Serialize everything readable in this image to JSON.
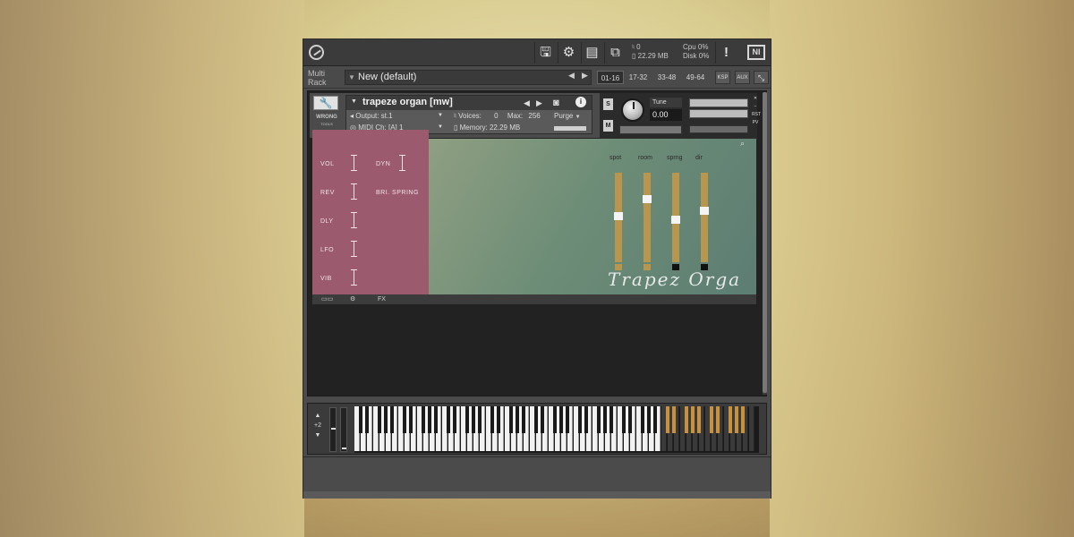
{
  "topbar": {
    "save_icon": "save-icon",
    "gear_icon": "gear-icon",
    "layout_icon": "layout-icon",
    "resize_icon": "resize-icon",
    "voices": "0",
    "memory": "22.29 MB",
    "cpu_label": "Cpu",
    "cpu_value": "0%",
    "disk_label": "Disk",
    "disk_value": "0%",
    "alert": "!",
    "ni_badge": "NI"
  },
  "rackbar": {
    "label_line1": "Multi",
    "label_line2": "Rack",
    "name": "New (default)",
    "tabs": [
      "01-16",
      "17-32",
      "33-48",
      "49-64"
    ],
    "ksp": "KSP",
    "aux": "AUX"
  },
  "instrument": {
    "title": "trapeze organ [mw]",
    "output_label": "Output:",
    "output_value": "st.1",
    "voices_label": "Voices:",
    "voices_value": "0",
    "max_label": "Max:",
    "max_value": "256",
    "purge_label": "Purge",
    "midi_label": "MIDI Ch:",
    "midi_value": "[A]  1",
    "memory_label": "Memory:",
    "memory_value": "22.29 MB",
    "tune_label": "Tune",
    "tune_value": "0.00",
    "s_label": "S",
    "m_label": "M",
    "logo_line1": "WRONG",
    "logo_line2": "TOOLS",
    "rst": "RST",
    "pv": "PV"
  },
  "pink_panel": {
    "vol": "VOL",
    "dyn": "DYN",
    "rev": "REV",
    "bri_spring": "BRI. SPRING",
    "dly": "DLY",
    "lfo": "LFO",
    "vib": "VIB"
  },
  "sliders": [
    {
      "label": "spot",
      "level": 0.52
    },
    {
      "label": "room",
      "level": 0.72
    },
    {
      "label": "sprng",
      "level": 0.47
    },
    {
      "label": "dir",
      "level": 0.58
    }
  ],
  "brand_script": "Trapez Orga",
  "bottom_strip": {
    "fx": "FX"
  },
  "keyboard": {
    "octave": "+2"
  }
}
